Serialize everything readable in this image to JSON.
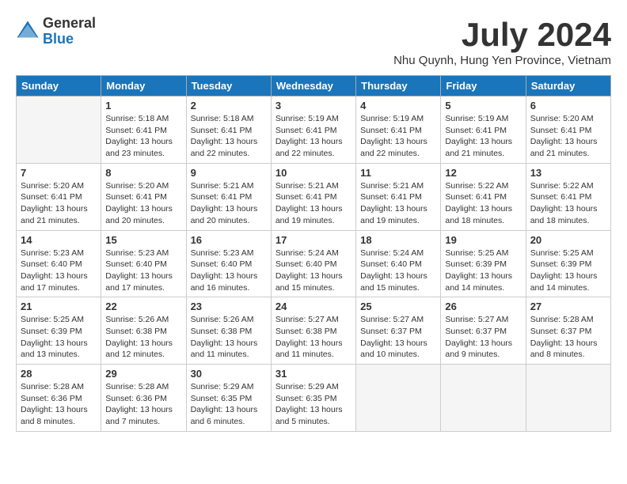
{
  "header": {
    "logo_general": "General",
    "logo_blue": "Blue",
    "month_title": "July 2024",
    "location": "Nhu Quynh, Hung Yen Province, Vietnam"
  },
  "days_of_week": [
    "Sunday",
    "Monday",
    "Tuesday",
    "Wednesday",
    "Thursday",
    "Friday",
    "Saturday"
  ],
  "weeks": [
    [
      {
        "day": "",
        "info": ""
      },
      {
        "day": "1",
        "info": "Sunrise: 5:18 AM\nSunset: 6:41 PM\nDaylight: 13 hours\nand 23 minutes."
      },
      {
        "day": "2",
        "info": "Sunrise: 5:18 AM\nSunset: 6:41 PM\nDaylight: 13 hours\nand 22 minutes."
      },
      {
        "day": "3",
        "info": "Sunrise: 5:19 AM\nSunset: 6:41 PM\nDaylight: 13 hours\nand 22 minutes."
      },
      {
        "day": "4",
        "info": "Sunrise: 5:19 AM\nSunset: 6:41 PM\nDaylight: 13 hours\nand 22 minutes."
      },
      {
        "day": "5",
        "info": "Sunrise: 5:19 AM\nSunset: 6:41 PM\nDaylight: 13 hours\nand 21 minutes."
      },
      {
        "day": "6",
        "info": "Sunrise: 5:20 AM\nSunset: 6:41 PM\nDaylight: 13 hours\nand 21 minutes."
      }
    ],
    [
      {
        "day": "7",
        "info": "Sunrise: 5:20 AM\nSunset: 6:41 PM\nDaylight: 13 hours\nand 21 minutes."
      },
      {
        "day": "8",
        "info": "Sunrise: 5:20 AM\nSunset: 6:41 PM\nDaylight: 13 hours\nand 20 minutes."
      },
      {
        "day": "9",
        "info": "Sunrise: 5:21 AM\nSunset: 6:41 PM\nDaylight: 13 hours\nand 20 minutes."
      },
      {
        "day": "10",
        "info": "Sunrise: 5:21 AM\nSunset: 6:41 PM\nDaylight: 13 hours\nand 19 minutes."
      },
      {
        "day": "11",
        "info": "Sunrise: 5:21 AM\nSunset: 6:41 PM\nDaylight: 13 hours\nand 19 minutes."
      },
      {
        "day": "12",
        "info": "Sunrise: 5:22 AM\nSunset: 6:41 PM\nDaylight: 13 hours\nand 18 minutes."
      },
      {
        "day": "13",
        "info": "Sunrise: 5:22 AM\nSunset: 6:41 PM\nDaylight: 13 hours\nand 18 minutes."
      }
    ],
    [
      {
        "day": "14",
        "info": "Sunrise: 5:23 AM\nSunset: 6:40 PM\nDaylight: 13 hours\nand 17 minutes."
      },
      {
        "day": "15",
        "info": "Sunrise: 5:23 AM\nSunset: 6:40 PM\nDaylight: 13 hours\nand 17 minutes."
      },
      {
        "day": "16",
        "info": "Sunrise: 5:23 AM\nSunset: 6:40 PM\nDaylight: 13 hours\nand 16 minutes."
      },
      {
        "day": "17",
        "info": "Sunrise: 5:24 AM\nSunset: 6:40 PM\nDaylight: 13 hours\nand 15 minutes."
      },
      {
        "day": "18",
        "info": "Sunrise: 5:24 AM\nSunset: 6:40 PM\nDaylight: 13 hours\nand 15 minutes."
      },
      {
        "day": "19",
        "info": "Sunrise: 5:25 AM\nSunset: 6:39 PM\nDaylight: 13 hours\nand 14 minutes."
      },
      {
        "day": "20",
        "info": "Sunrise: 5:25 AM\nSunset: 6:39 PM\nDaylight: 13 hours\nand 14 minutes."
      }
    ],
    [
      {
        "day": "21",
        "info": "Sunrise: 5:25 AM\nSunset: 6:39 PM\nDaylight: 13 hours\nand 13 minutes."
      },
      {
        "day": "22",
        "info": "Sunrise: 5:26 AM\nSunset: 6:38 PM\nDaylight: 13 hours\nand 12 minutes."
      },
      {
        "day": "23",
        "info": "Sunrise: 5:26 AM\nSunset: 6:38 PM\nDaylight: 13 hours\nand 11 minutes."
      },
      {
        "day": "24",
        "info": "Sunrise: 5:27 AM\nSunset: 6:38 PM\nDaylight: 13 hours\nand 11 minutes."
      },
      {
        "day": "25",
        "info": "Sunrise: 5:27 AM\nSunset: 6:37 PM\nDaylight: 13 hours\nand 10 minutes."
      },
      {
        "day": "26",
        "info": "Sunrise: 5:27 AM\nSunset: 6:37 PM\nDaylight: 13 hours\nand 9 minutes."
      },
      {
        "day": "27",
        "info": "Sunrise: 5:28 AM\nSunset: 6:37 PM\nDaylight: 13 hours\nand 8 minutes."
      }
    ],
    [
      {
        "day": "28",
        "info": "Sunrise: 5:28 AM\nSunset: 6:36 PM\nDaylight: 13 hours\nand 8 minutes."
      },
      {
        "day": "29",
        "info": "Sunrise: 5:28 AM\nSunset: 6:36 PM\nDaylight: 13 hours\nand 7 minutes."
      },
      {
        "day": "30",
        "info": "Sunrise: 5:29 AM\nSunset: 6:35 PM\nDaylight: 13 hours\nand 6 minutes."
      },
      {
        "day": "31",
        "info": "Sunrise: 5:29 AM\nSunset: 6:35 PM\nDaylight: 13 hours\nand 5 minutes."
      },
      {
        "day": "",
        "info": ""
      },
      {
        "day": "",
        "info": ""
      },
      {
        "day": "",
        "info": ""
      }
    ]
  ]
}
